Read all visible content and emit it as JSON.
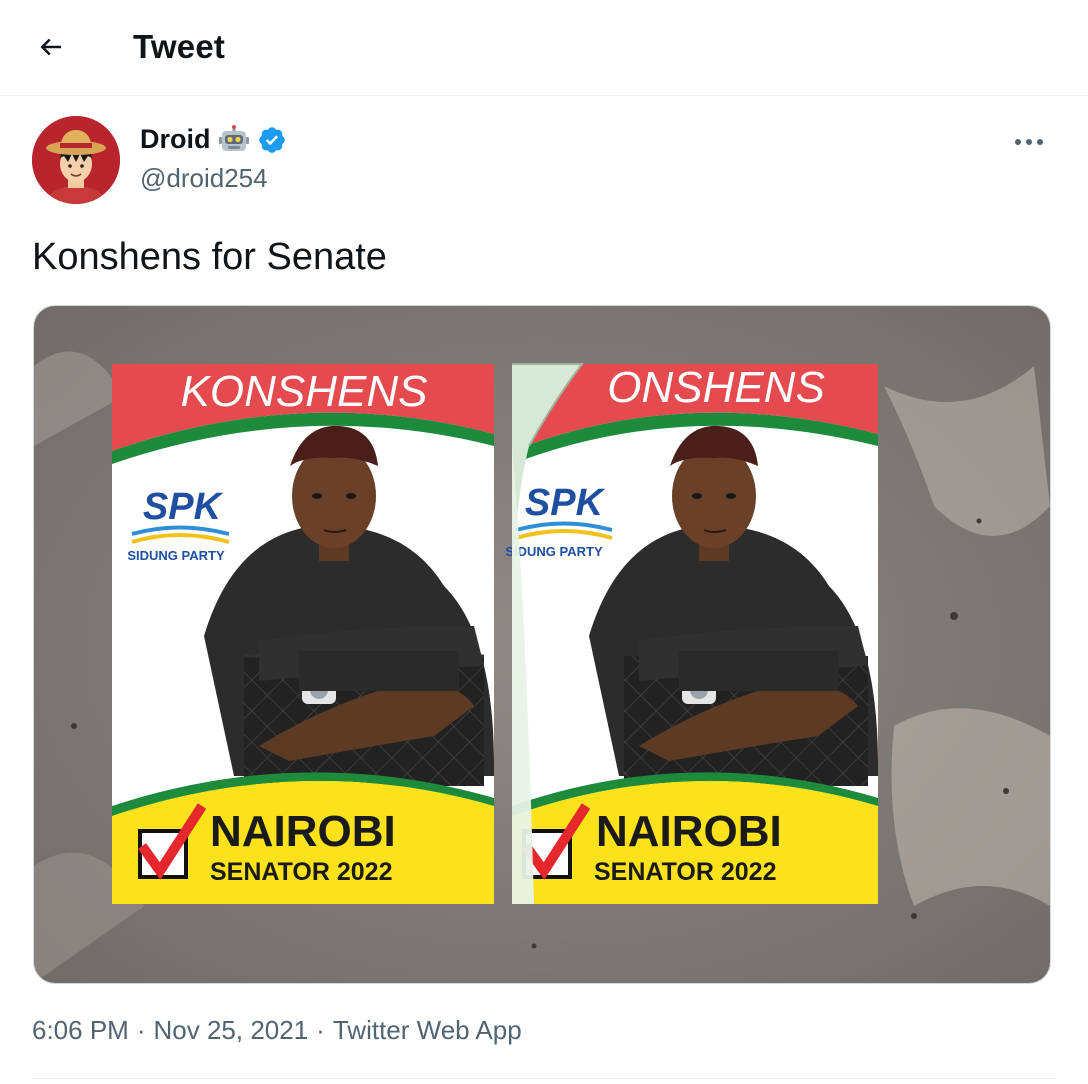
{
  "header": {
    "title": "Tweet"
  },
  "tweet": {
    "author": {
      "name": "Droid",
      "handle": "@droid254"
    },
    "text": "Konshens for Senate",
    "time": "6:06 PM",
    "date": "Nov 25, 2021",
    "separator": "·",
    "source": "Twitter Web App"
  },
  "poster": {
    "name": "KONSHENS",
    "name_peeled": "ONSHENS",
    "party_abbrev": "SPK",
    "party_name": "SIDUNG PARTY",
    "party_name_peeled": "SIDUNG PARTY",
    "city": "NAIROBI",
    "office": "SENATOR 2022"
  },
  "colors": {
    "accent": "#1d9bf0",
    "text_primary": "#0f1419",
    "text_secondary": "#536471",
    "poster_red": "#e54a4f",
    "poster_yellow": "#fbe21a",
    "poster_green": "#1e8a3c"
  },
  "icons": {
    "back": "arrow-left-icon",
    "robot": "robot-emoji-icon",
    "verified": "verified-badge-icon",
    "more": "more-horizontal-icon"
  }
}
